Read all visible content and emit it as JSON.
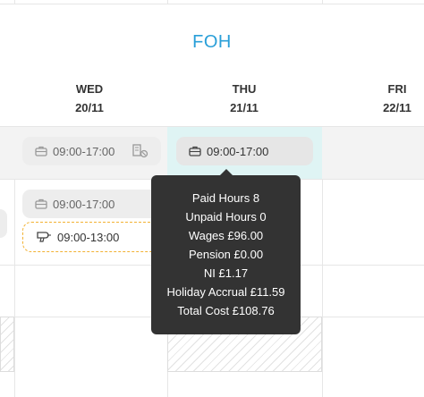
{
  "group": {
    "title": "FOH"
  },
  "days": [
    {
      "name": "WED",
      "date": "20/11"
    },
    {
      "name": "THU",
      "date": "21/11"
    },
    {
      "name": "FRI",
      "date": "22/11"
    }
  ],
  "shifts": {
    "wed_1": {
      "time": "09:00-17:00",
      "icon": "briefcase-icon",
      "extra_icon": "shift-swap-icon"
    },
    "thu_1": {
      "time": "09:00-17:00",
      "icon": "briefcase-icon"
    },
    "wed_2": {
      "time": "09:00-17:00",
      "icon": "briefcase-icon"
    },
    "wed_3": {
      "time": "09:00-13:00",
      "icon": "hairdryer-icon"
    }
  },
  "tooltip": {
    "paid_hours": "Paid Hours 8",
    "unpaid_hours": "Unpaid Hours 0",
    "wages": "Wages £96.00",
    "pension": "Pension £0.00",
    "ni": "NI £1.17",
    "holiday_accrual": "Holiday Accrual £11.59",
    "total_cost": "Total Cost £108.76"
  },
  "colors": {
    "group_title": "#2a9fd8",
    "today_highlight": "#dff4f4",
    "tooltip_bg": "#333333",
    "pending_border": "#f2b233"
  }
}
